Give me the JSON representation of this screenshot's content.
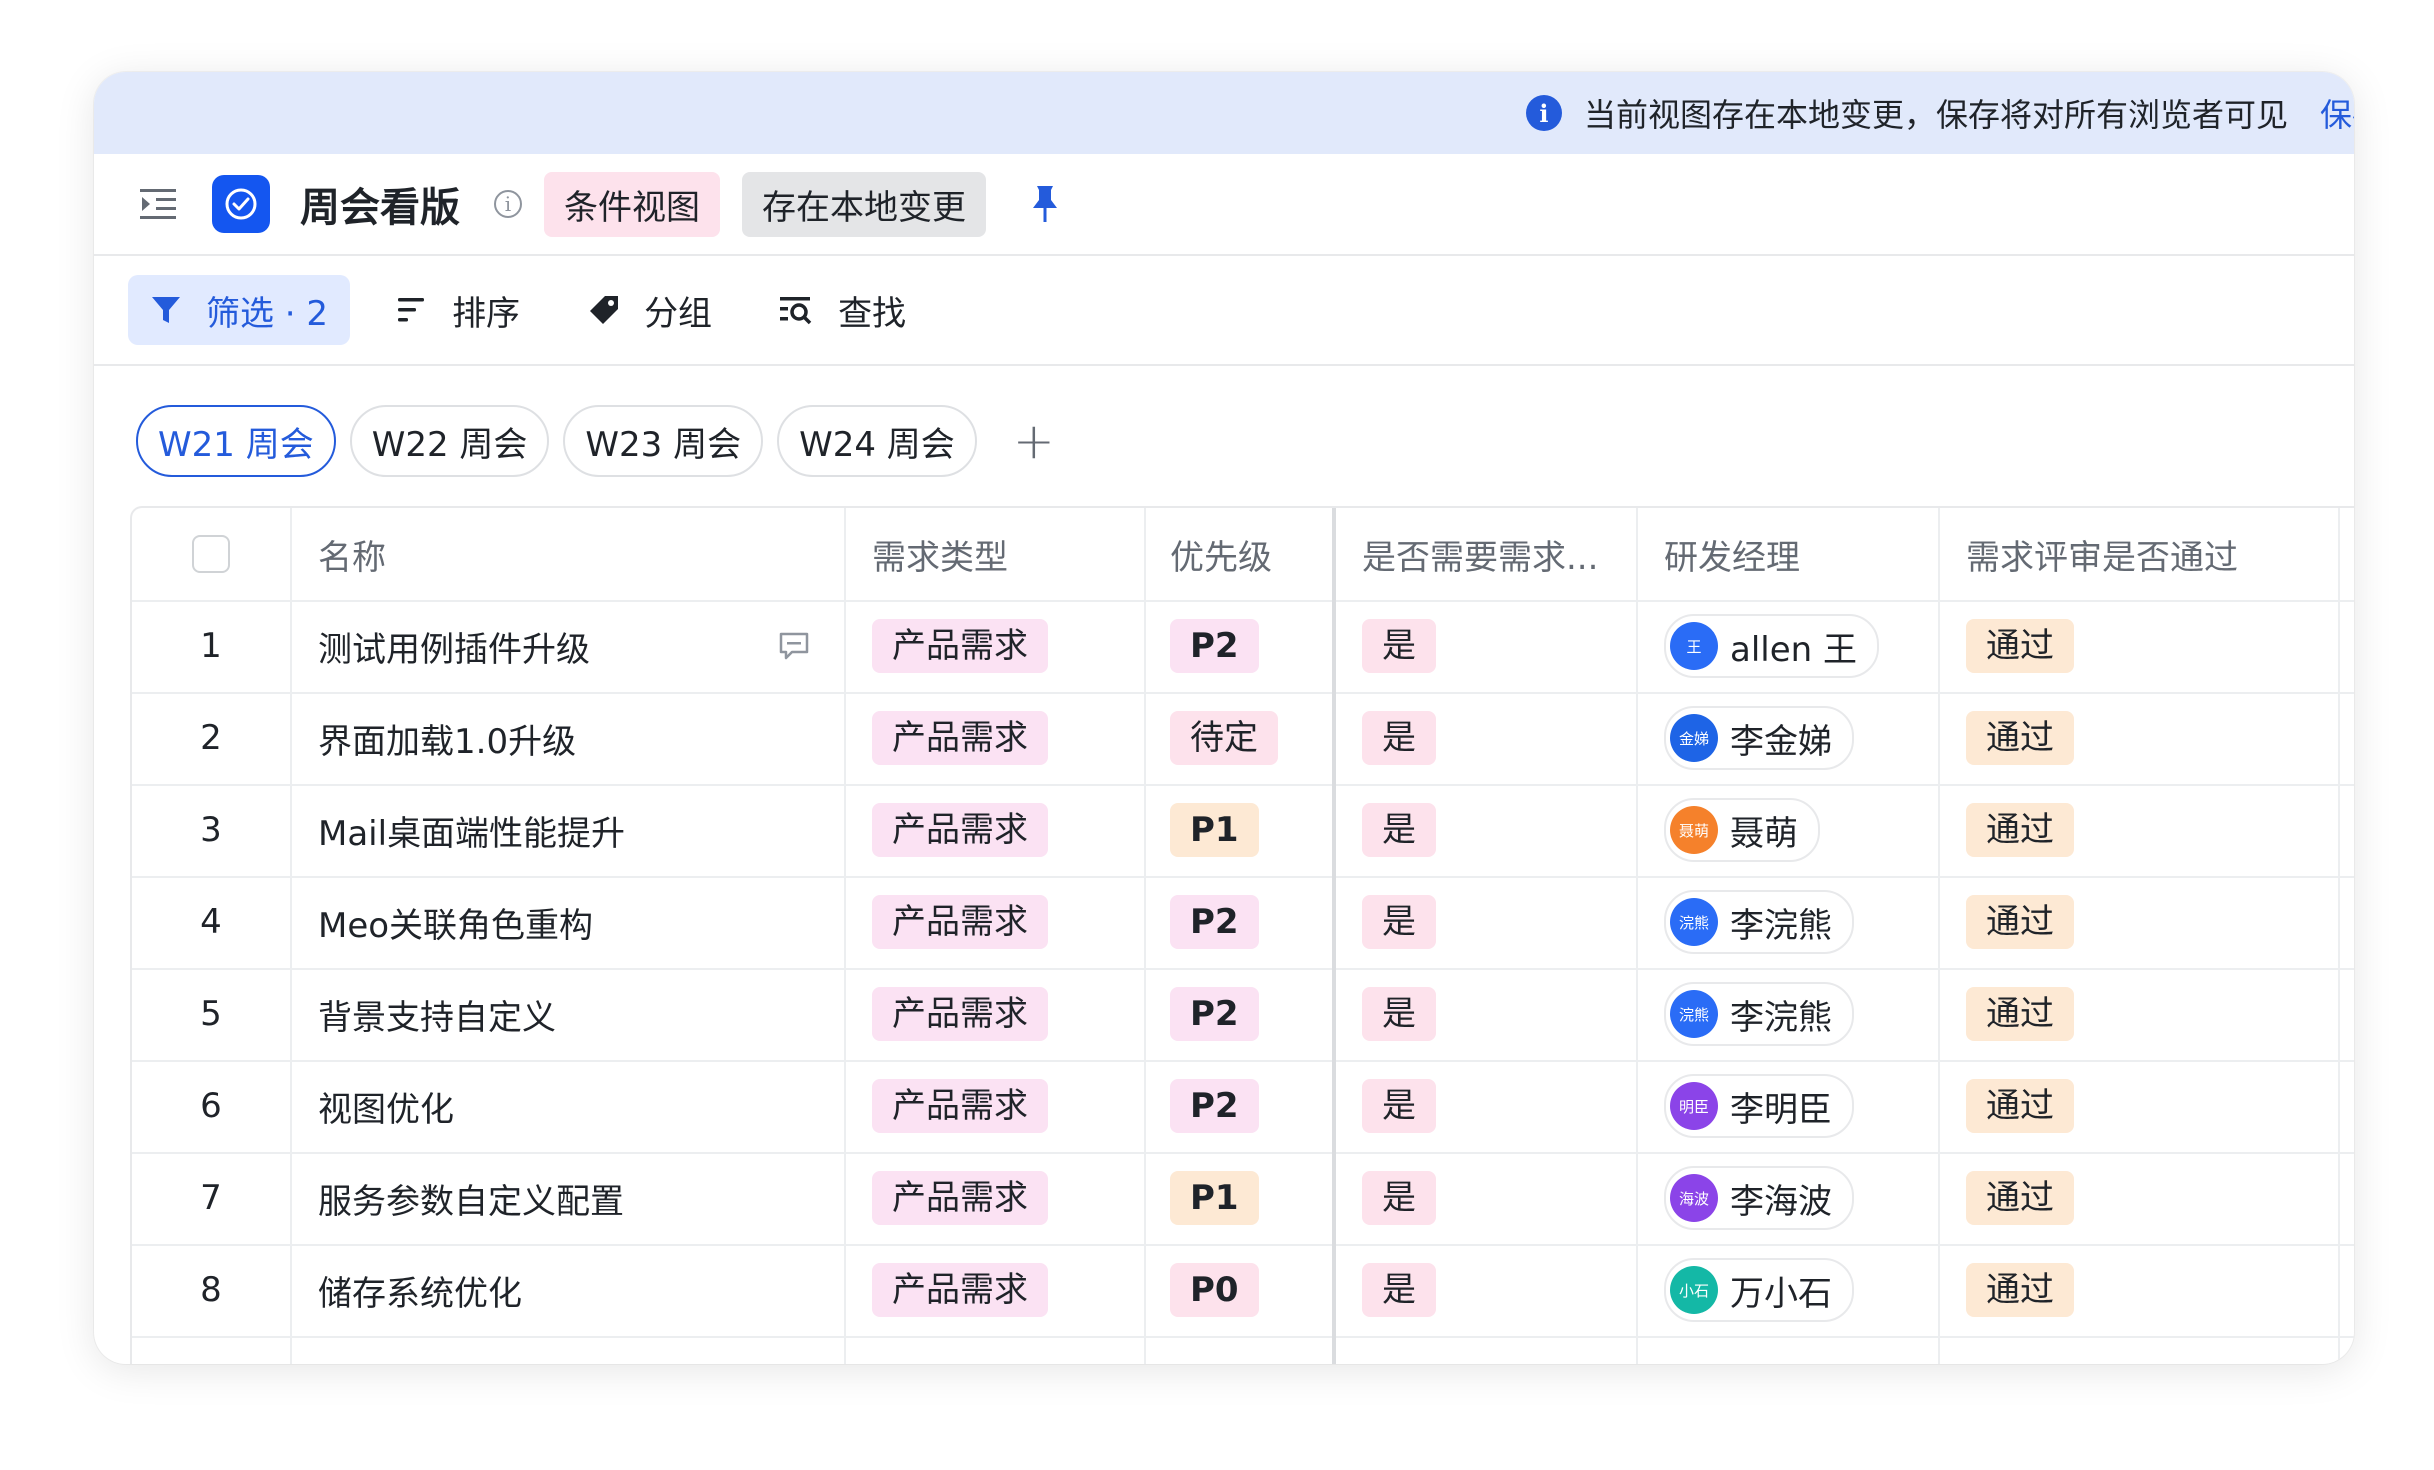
{
  "banner": {
    "message": "当前视图存在本地变更，保存将对所有浏览者可见",
    "save_label": "保存"
  },
  "header": {
    "title": "周会看版",
    "condition_view_label": "条件视图",
    "local_change_label": "存在本地变更"
  },
  "toolbar": {
    "filter_label": "筛选 · 2",
    "sort_label": "排序",
    "group_label": "分组",
    "find_label": "查找"
  },
  "tabs": [
    "W21 周会",
    "W22 周会",
    "W23 周会",
    "W24 周会"
  ],
  "table": {
    "columns": [
      "名称",
      "需求类型",
      "优先级",
      "是否需要需求...",
      "研发经理",
      "需求评审是否通过"
    ],
    "rows": [
      {
        "num": "1",
        "name": "测试用例插件升级",
        "type": "产品需求",
        "priority": "P2",
        "need": "是",
        "manager": "allen 王",
        "avatar": "王",
        "avatar_color": "#2a6cf6",
        "review": "通过"
      },
      {
        "num": "2",
        "name": "界面加载1.0升级",
        "type": "产品需求",
        "priority": "待定",
        "need": "是",
        "manager": "李金娣",
        "avatar": "金娣",
        "avatar_color": "#1e64e6",
        "review": "通过"
      },
      {
        "num": "3",
        "name": "Mail桌面端性能提升",
        "type": "产品需求",
        "priority": "P1",
        "need": "是",
        "manager": "聂萌",
        "avatar": "聂萌",
        "avatar_color": "#f5812b",
        "review": "通过"
      },
      {
        "num": "4",
        "name": "Meo关联角色重构",
        "type": "产品需求",
        "priority": "P2",
        "need": "是",
        "manager": "李浣熊",
        "avatar": "浣熊",
        "avatar_color": "#2a6cf6",
        "review": "通过"
      },
      {
        "num": "5",
        "name": "背景支持自定义",
        "type": "产品需求",
        "priority": "P2",
        "need": "是",
        "manager": "李浣熊",
        "avatar": "浣熊",
        "avatar_color": "#2a6cf6",
        "review": "通过"
      },
      {
        "num": "6",
        "name": "视图优化",
        "type": "产品需求",
        "priority": "P2",
        "need": "是",
        "manager": "李明臣",
        "avatar": "明臣",
        "avatar_color": "#8b44e8",
        "review": "通过"
      },
      {
        "num": "7",
        "name": "服务参数自定义配置",
        "type": "产品需求",
        "priority": "P1",
        "need": "是",
        "manager": "李海波",
        "avatar": "海波",
        "avatar_color": "#8b44e8",
        "review": "通过"
      },
      {
        "num": "8",
        "name": "储存系统优化",
        "type": "产品需求",
        "priority": "P0",
        "need": "是",
        "manager": "万小石",
        "avatar": "小石",
        "avatar_color": "#14b8a6",
        "review": "通过"
      }
    ]
  },
  "colors": {
    "accent": "#245bdb",
    "banner_bg": "#e1e9fb"
  }
}
